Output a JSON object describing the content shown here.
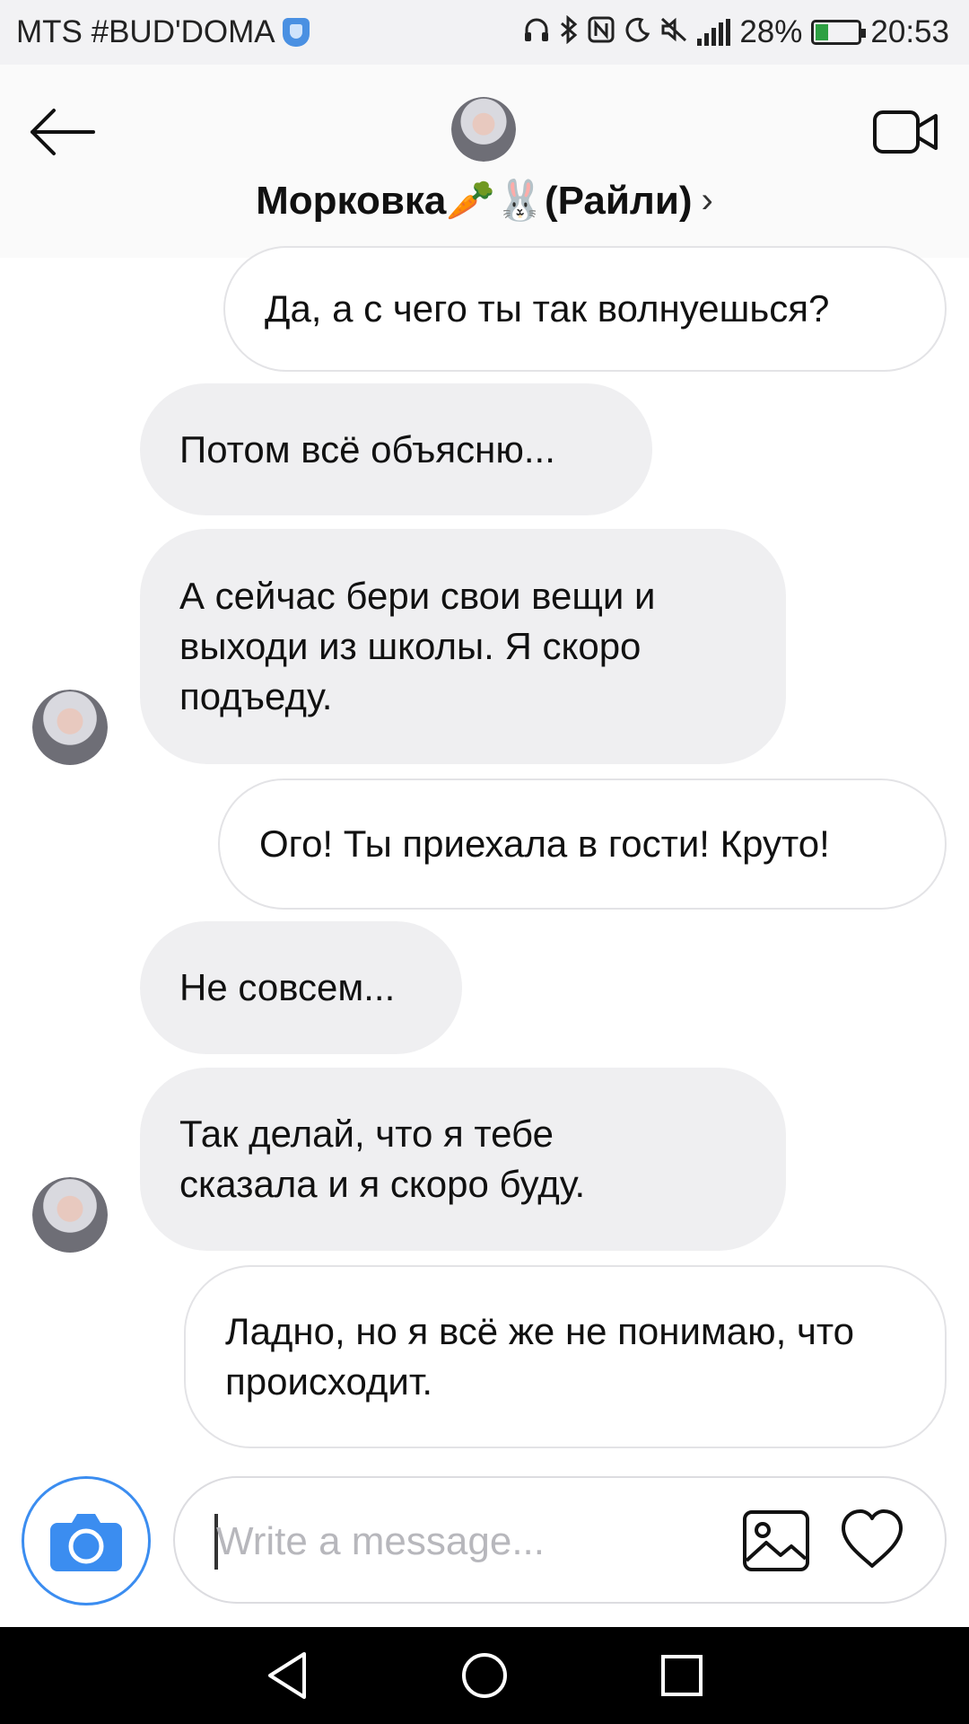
{
  "status_bar": {
    "carrier": "MTS #BUD'DOMA",
    "battery_percent_text": "28%",
    "battery_level": 0.28,
    "time": "20:53",
    "icons": [
      "headphones-icon",
      "bluetooth-icon",
      "nfc-icon",
      "moon-icon",
      "mute-icon",
      "signal-icon",
      "battery-icon"
    ]
  },
  "header": {
    "contact_name": "Морковка🥕🐰(Райли)",
    "chevron": "›"
  },
  "messages": [
    {
      "side": "out",
      "text": "Да, а с чего ты так волнуешься?"
    },
    {
      "side": "in",
      "text": "Потом всё объясню..."
    },
    {
      "side": "in",
      "text": "А сейчас бери свои вещи и выходи из школы. Я скоро подъеду."
    },
    {
      "side": "out",
      "text": "Ого! Ты приехала в гости! Круто!"
    },
    {
      "side": "in",
      "text": "Не совсем..."
    },
    {
      "side": "in",
      "text": "Так делай, что я тебе сказала и я скоро буду."
    },
    {
      "side": "out",
      "text": "Ладно, но я всё же не понимаю, что происходит."
    }
  ],
  "composer": {
    "placeholder": "Write a message..."
  },
  "colors": {
    "accent": "#3b8df0",
    "incoming_bubble": "#efeff1",
    "outgoing_border": "#e3e3e6"
  }
}
